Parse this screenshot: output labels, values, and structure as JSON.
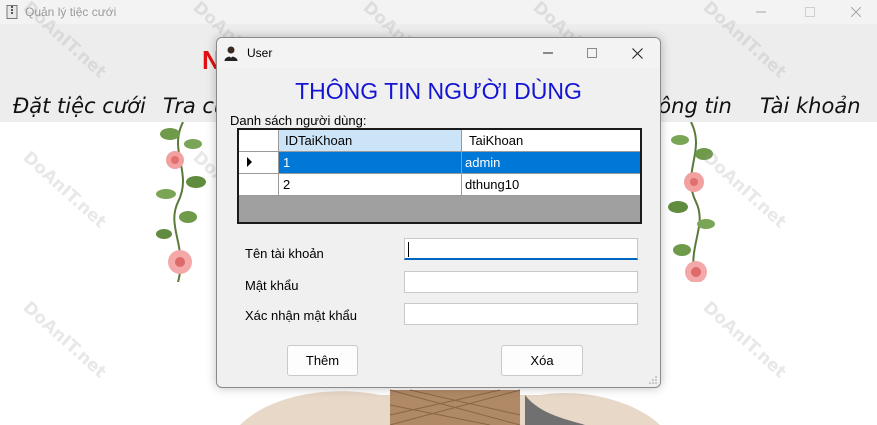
{
  "main_window": {
    "title": "Quản lý tiệc cưới",
    "title_fragment": "N",
    "menu": {
      "dat_tiec": "Đặt tiệc cưới",
      "tra_cuu": "Tra cứ",
      "thong_tin": "hông tin",
      "tai_khoan": "Tài khoản"
    },
    "icons": {
      "app": "zip-file-icon",
      "minimize": "minimize-icon",
      "maximize": "maximize-icon",
      "close": "close-icon"
    }
  },
  "watermark_text": "DoAnIT.net",
  "dialog": {
    "title": "User",
    "heading": "THÔNG TIN NGƯỜI DÙNG",
    "list_label": "Danh sách người dùng:",
    "grid": {
      "columns": [
        "IDTaiKhoan",
        "TaiKhoan"
      ],
      "rows": [
        {
          "id": "1",
          "account": "admin",
          "selected": true
        },
        {
          "id": "2",
          "account": "dthung10",
          "selected": false
        }
      ]
    },
    "fields": {
      "username_label": "Tên tài khoản",
      "username_value": "",
      "password_label": "Mật khẩu",
      "password_value": "",
      "confirm_label": "Xác nhận mật khẩu",
      "confirm_value": ""
    },
    "buttons": {
      "add": "Thêm",
      "delete": "Xóa"
    },
    "icons": {
      "app": "user-icon",
      "minimize": "minimize-icon",
      "maximize": "maximize-icon",
      "close": "close-icon",
      "grip": "resize-grip-icon"
    },
    "colors": {
      "heading": "#1414d4",
      "selection": "#0078d7",
      "header_highlight": "#cce4f7"
    }
  }
}
